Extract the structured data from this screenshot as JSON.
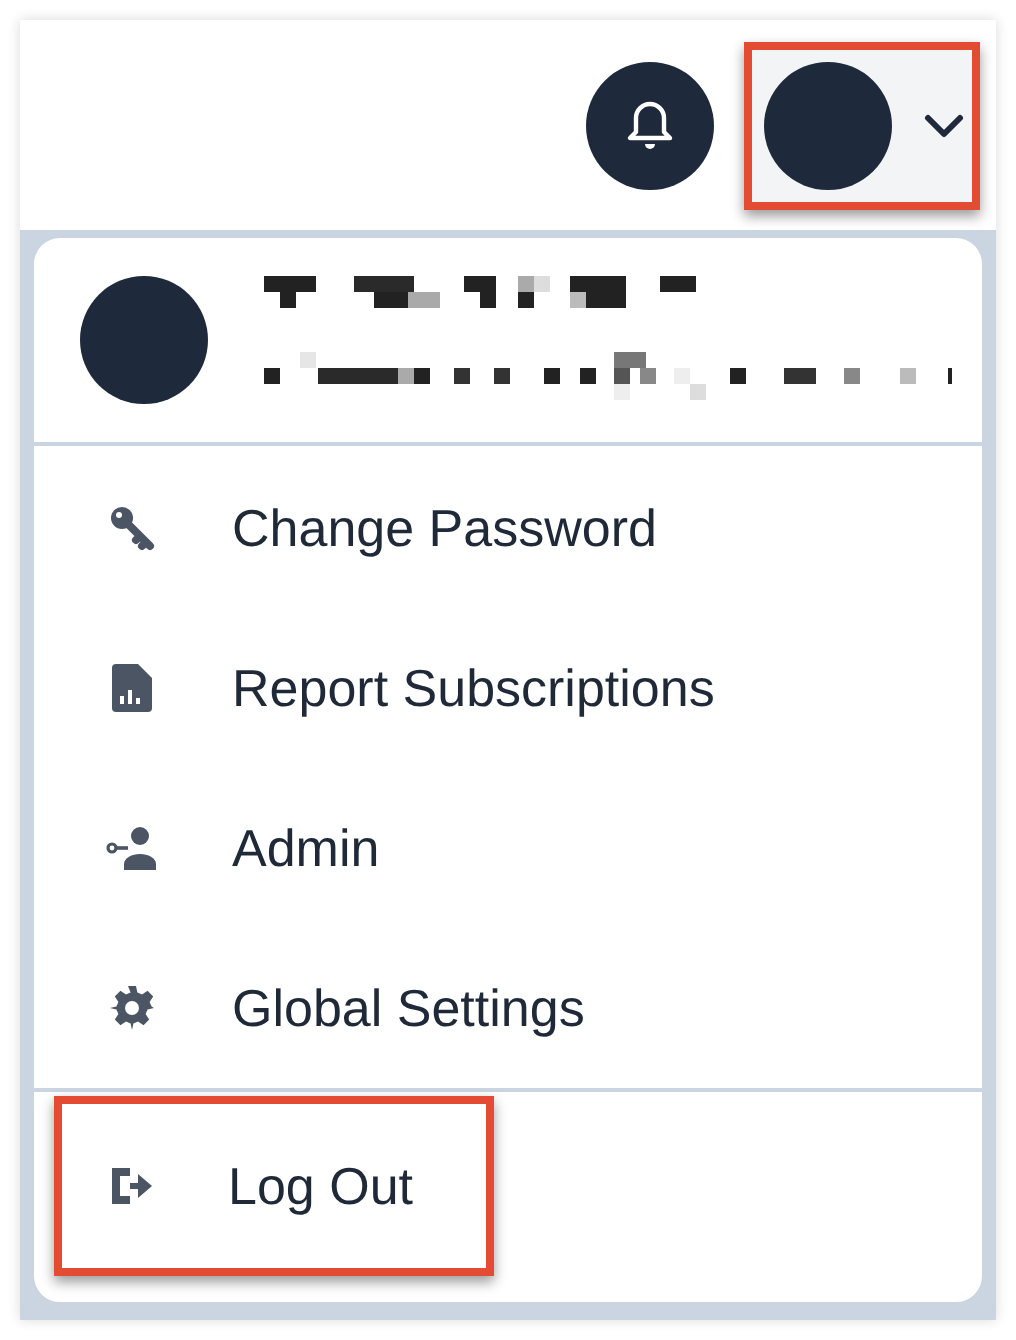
{
  "header": {
    "user_menu_button": {
      "highlighted": true
    }
  },
  "user_menu": {
    "items": [
      {
        "label": "Change Password"
      },
      {
        "label": "Report Subscriptions"
      },
      {
        "label": "Admin"
      },
      {
        "label": "Global Settings"
      }
    ],
    "log_out": {
      "label": "Log Out",
      "highlighted": true
    }
  }
}
